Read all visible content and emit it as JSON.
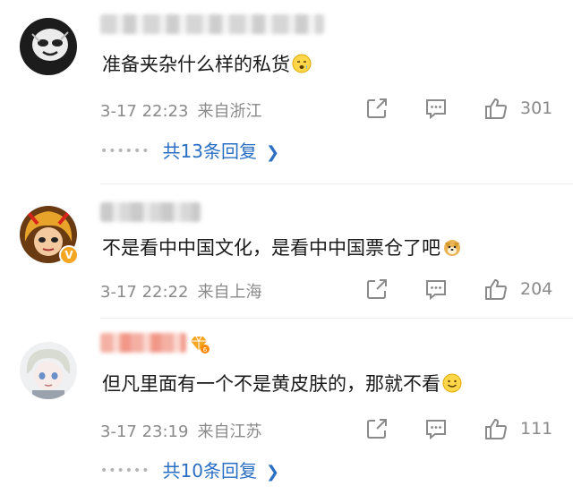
{
  "comments": [
    {
      "text": "准备夹杂什么样的私货",
      "date": "3-17 22:23",
      "location": "来自浙江",
      "likes": "301",
      "replies_label": "共13条回复"
    },
    {
      "text": "不是看中中国文化，是看中中国票仓了吧",
      "date": "3-17 22:22",
      "location": "来自上海",
      "likes": "204",
      "replies_label": ""
    },
    {
      "text": "但凡里面有一个不是黄皮肤的，那就不看",
      "date": "3-17 23:19",
      "location": "来自江苏",
      "likes": "111",
      "replies_label": "共10条回复"
    }
  ],
  "icons": {
    "share": "share-icon",
    "comment": "comment-icon",
    "like": "thumbs-up-icon",
    "replies_arrow": "chevron-right-icon"
  },
  "colors": {
    "link": "#2a6fc4",
    "meta": "#8a8a8a",
    "badge": "#f5a623"
  }
}
